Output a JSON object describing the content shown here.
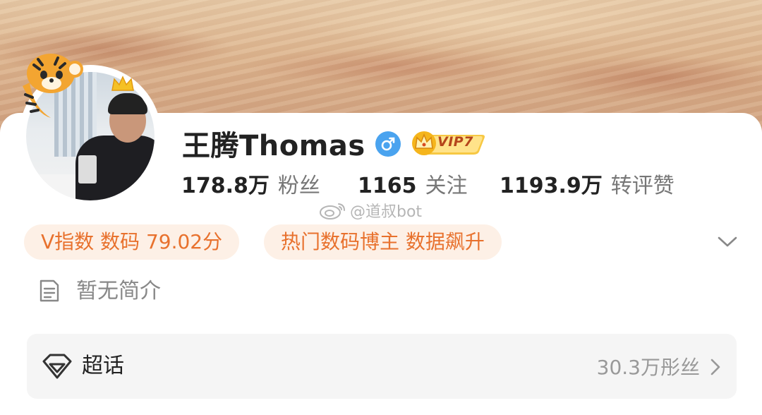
{
  "profile": {
    "name": "王腾Thomas",
    "gender_symbol": "♂",
    "vip_label": "VIP7"
  },
  "stats": {
    "followers": {
      "value": "178.8万",
      "label": "粉丝"
    },
    "following": {
      "value": "1165",
      "label": "关注"
    },
    "interactions": {
      "value": "1193.9万",
      "label": "转评赞"
    }
  },
  "watermark": "@道叔bot",
  "tags": [
    {
      "text": "V指数 数码 79.02分"
    },
    {
      "text": "热门数码博主 数据飙升"
    }
  ],
  "intro": {
    "text": "暂无简介"
  },
  "super_topic": {
    "title": "超话",
    "count": "30.3万彤丝"
  },
  "colors": {
    "tag_text": "#e8712d",
    "tag_bg": "#fdf0e6",
    "gender_badge": "#4aa3ef",
    "vip_gold": "#f5b51c"
  },
  "icons": {
    "gender": "male-icon",
    "vip": "crown-icon",
    "expand": "chevron-down-icon",
    "intro": "document-icon",
    "super_topic": "diamond-icon",
    "arrow": "chevron-right-icon",
    "watermark": "weibo-logo-icon"
  }
}
